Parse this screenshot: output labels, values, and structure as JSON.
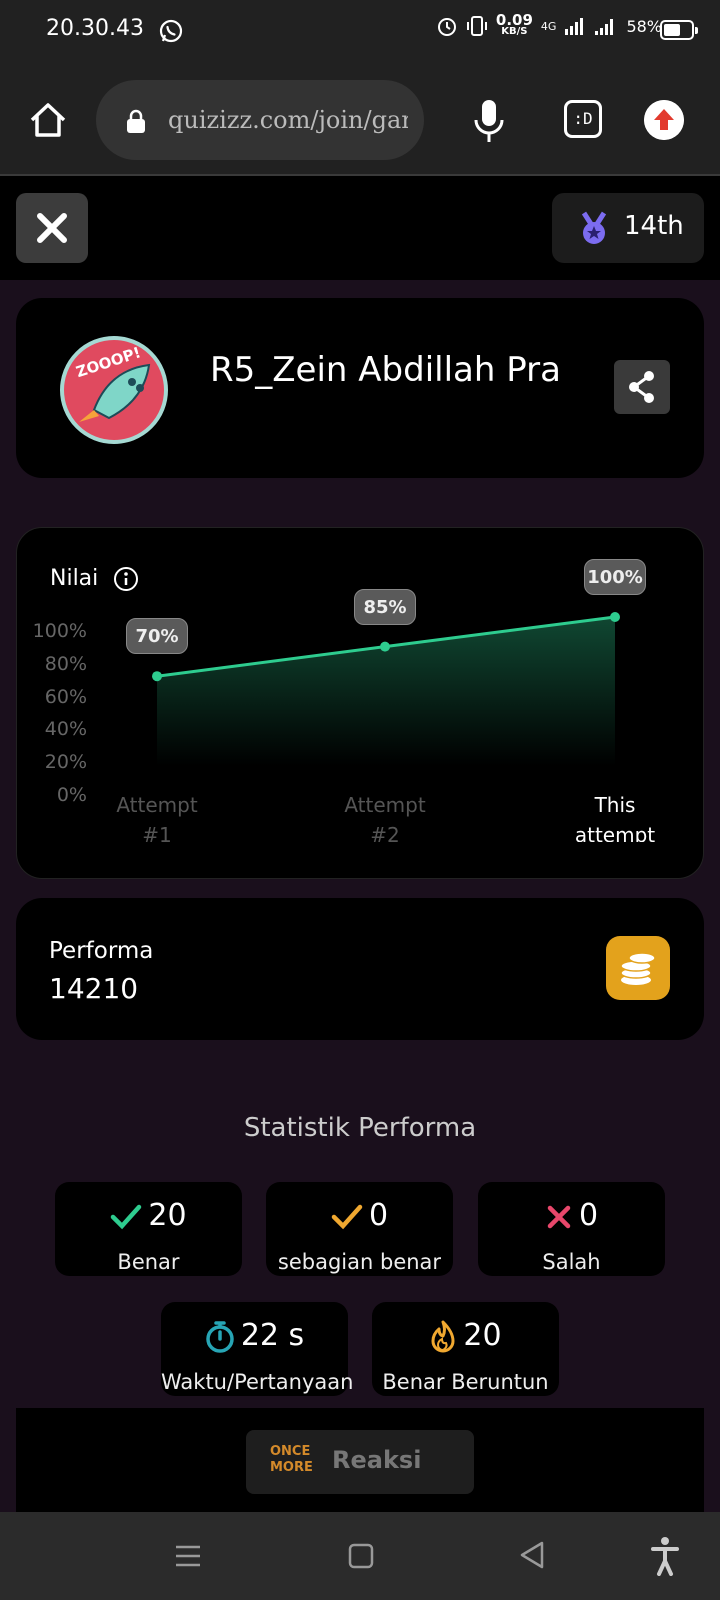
{
  "status_bar": {
    "time": "20.30.43",
    "net_speed_value": "0.09",
    "net_speed_unit": "KB/S",
    "network": "4G",
    "battery": "58%"
  },
  "browser": {
    "url": "quizizz.com/join/gam",
    "tabs_label": ":D"
  },
  "header": {
    "rank": "14th"
  },
  "profile": {
    "username": "R5_Zein Abdillah Pra"
  },
  "chart_data": {
    "type": "area",
    "title": "Nilai",
    "categories": [
      "Attempt #1",
      "Attempt #2",
      "This attempt"
    ],
    "values": [
      70,
      85,
      100
    ],
    "data_labels": [
      "70%",
      "85%",
      "100%"
    ],
    "y_ticks": [
      "100%",
      "80%",
      "60%",
      "40%",
      "20%",
      "0%"
    ],
    "x_tick_lines": [
      [
        "Attempt",
        "#1"
      ],
      [
        "Attempt",
        "#2"
      ],
      [
        "This",
        "attempt"
      ]
    ],
    "ylim": [
      0,
      100
    ],
    "line_color": "#2ecc8f"
  },
  "performance": {
    "label": "Performa",
    "value": "14210"
  },
  "stats": {
    "title": "Statistik Performa",
    "correct": {
      "value": "20",
      "label": "Benar"
    },
    "partial": {
      "value": "0",
      "label": "sebagian benar"
    },
    "wrong": {
      "value": "0",
      "label": "Salah"
    },
    "time": {
      "value": "22 s",
      "label": "Waktu/Pertanyaan"
    },
    "streak": {
      "value": "20",
      "label": "Benar Beruntun"
    }
  },
  "reaksi": {
    "logo_line1": "ONCE",
    "logo_line2": "MORE",
    "label": "Reaksi"
  },
  "colors": {
    "correct": "#2ecc8f",
    "partial": "#f0a830",
    "wrong": "#e8476b",
    "time": "#27a5b5",
    "streak": "#f0a830"
  }
}
